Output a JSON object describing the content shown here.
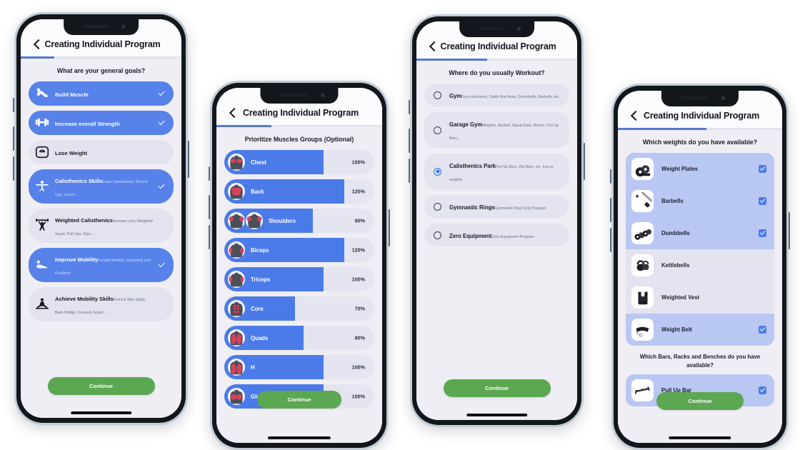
{
  "app": {
    "title": "Creating Individual Program",
    "back_icon": "chevron-left-icon",
    "continue_label": "Continue"
  },
  "phones": [
    {
      "id": "phone-goals",
      "progress_percent": 21,
      "question": "What are your general goals?",
      "goals": [
        {
          "title": "Build Muscle",
          "subtitle": "",
          "icon": "bicep-flex-icon",
          "selected": true
        },
        {
          "title": "Increase overall Strength",
          "subtitle": "",
          "icon": "dumbbell-icon",
          "selected": true
        },
        {
          "title": "Lose Weight",
          "subtitle": "",
          "icon": "weight-scale-icon",
          "selected": false
        },
        {
          "title": "Calisthenics Skills",
          "subtitle": "Learn Handstands, Muscle Ups, Levers ...",
          "icon": "planche-icon",
          "selected": true
        },
        {
          "title": "Weighted Calisthenics",
          "subtitle": "Increase your Weighted Squat, Pull Ups, Dips, ...",
          "icon": "overhead-press-icon",
          "selected": false
        },
        {
          "title": "Improve Mobility",
          "subtitle": "Include Mobility, Stretching and Flexibility",
          "icon": "stretching-icon",
          "selected": true
        },
        {
          "title": "Achieve Mobility Skills",
          "subtitle": "Front & Side Splits, Back Bridge, Cossack Squat, ...",
          "icon": "splits-icon",
          "selected": false
        }
      ]
    },
    {
      "id": "phone-muscles",
      "progress_percent": 33,
      "question": "Prioritize Muscles Groups (Optional)",
      "muscles": [
        {
          "name": "Chest",
          "percent_label": "100%",
          "value": 100,
          "fill_percent": 66,
          "icons": 1,
          "icon": "chest-anatomy-icon"
        },
        {
          "name": "Back",
          "percent_label": "120%",
          "value": 120,
          "fill_percent": 80,
          "icons": 1,
          "icon": "back-anatomy-icon"
        },
        {
          "name": "Shoulders",
          "percent_label": "90%",
          "value": 90,
          "fill_percent": 59,
          "icons": 2,
          "icon": "shoulders-anatomy-icon"
        },
        {
          "name": "Biceps",
          "percent_label": "120%",
          "value": 120,
          "fill_percent": 80,
          "icons": 1,
          "icon": "biceps-anatomy-icon"
        },
        {
          "name": "Triceps",
          "percent_label": "100%",
          "value": 100,
          "fill_percent": 66,
          "icons": 1,
          "icon": "triceps-anatomy-icon"
        },
        {
          "name": "Core",
          "percent_label": "70%",
          "value": 70,
          "fill_percent": 47,
          "icons": 1,
          "icon": "core-anatomy-icon"
        },
        {
          "name": "Quads",
          "percent_label": "80%",
          "value": 80,
          "fill_percent": 53,
          "icons": 1,
          "icon": "quads-anatomy-icon"
        },
        {
          "name": "H",
          "percent_label": "100%",
          "value": 100,
          "fill_percent": 66,
          "icons": 1,
          "icon": "hamstrings-anatomy-icon"
        },
        {
          "name": "Glutes",
          "percent_label": "100%",
          "value": 100,
          "fill_percent": 66,
          "icons": 1,
          "icon": "glutes-anatomy-icon"
        }
      ]
    },
    {
      "id": "phone-location",
      "progress_percent": 44,
      "question": "Where do you usually Workout?",
      "locations": [
        {
          "title": "Gym",
          "subtitle": "Gym machines, Cable Machines, Dumbbells, Barbells, etc.",
          "selected": false
        },
        {
          "title": "Garage Gym",
          "subtitle": "Weights, Barbell, Squat Rack, Bench, Pull Up Bars...",
          "selected": false
        },
        {
          "title": "Calisthenics Park",
          "subtitle": "Pull Up Bars, Dip Bars, etc. but no weights",
          "selected": true
        },
        {
          "title": "Gymnastic Rings",
          "subtitle": "Gymnastic Ring Only Program",
          "selected": false
        },
        {
          "title": "Zero Equipment",
          "subtitle": "Zero Equipment Program",
          "selected": false
        }
      ]
    },
    {
      "id": "phone-equipment",
      "progress_percent": 54,
      "question": "Which weights do you have available?",
      "second_heading": "Which Bars, Racks and Benches do you have available?",
      "weights": [
        {
          "name": "Weight Plates",
          "icon": "weight-plates-icon",
          "checked": true
        },
        {
          "name": "Barbells",
          "icon": "barbell-icon",
          "checked": true
        },
        {
          "name": "Dumbbells",
          "icon": "dumbbells-icon",
          "checked": true
        },
        {
          "name": "Kettlebells",
          "icon": "kettlebells-icon",
          "checked": false
        },
        {
          "name": "Weighted Vest",
          "icon": "weighted-vest-icon",
          "checked": false
        },
        {
          "name": "Weight Belt",
          "icon": "weight-belt-icon",
          "checked": true
        }
      ],
      "bars": [
        {
          "name": "Pull Up Bar",
          "icon": "pull-up-bar-icon",
          "checked": true
        }
      ]
    }
  ],
  "colors": {
    "accent_blue": "#4b7be8",
    "selected_card_blue": "#5682ea",
    "unselected_card": "#e2e3ef",
    "highlight_row": "#b9c7f3",
    "continue_green": "#5ca751",
    "progress_blue": "#5577d6",
    "screen_bg": "#eeeef4",
    "muscle_accent_red": "#d9405e"
  }
}
